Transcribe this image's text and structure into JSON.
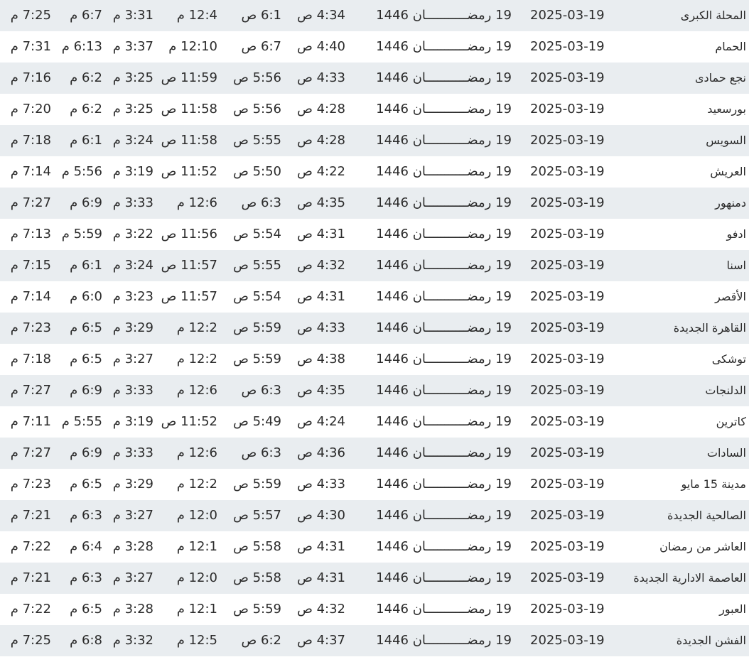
{
  "rows": [
    {
      "city": "المحلة الكبرى",
      "date": "2025-03-19",
      "hijri": "19 رمضـــــــــــان 1446",
      "fajr": "4:34 ص",
      "sunrise": "6:1 ص",
      "dhuhr": "12:4 م",
      "asr": "3:31 م",
      "maghrib": "6:7 م",
      "isha": "7:25 م"
    },
    {
      "city": "الحمام",
      "date": "2025-03-19",
      "hijri": "19 رمضـــــــــــان 1446",
      "fajr": "4:40 ص",
      "sunrise": "6:7 ص",
      "dhuhr": "12:10 م",
      "asr": "3:37 م",
      "maghrib": "6:13 م",
      "isha": "7:31 م"
    },
    {
      "city": "نجع حمادى",
      "date": "2025-03-19",
      "hijri": "19 رمضـــــــــــان 1446",
      "fajr": "4:33 ص",
      "sunrise": "5:56 ص",
      "dhuhr": "11:59 ص",
      "asr": "3:25 م",
      "maghrib": "6:2 م",
      "isha": "7:16 م"
    },
    {
      "city": "بورسعيد",
      "date": "2025-03-19",
      "hijri": "19 رمضـــــــــــان 1446",
      "fajr": "4:28 ص",
      "sunrise": "5:56 ص",
      "dhuhr": "11:58 ص",
      "asr": "3:25 م",
      "maghrib": "6:2 م",
      "isha": "7:20 م"
    },
    {
      "city": "السويس",
      "date": "2025-03-19",
      "hijri": "19 رمضـــــــــــان 1446",
      "fajr": "4:28 ص",
      "sunrise": "5:55 ص",
      "dhuhr": "11:58 ص",
      "asr": "3:24 م",
      "maghrib": "6:1 م",
      "isha": "7:18 م"
    },
    {
      "city": "العريش",
      "date": "2025-03-19",
      "hijri": "19 رمضـــــــــــان 1446",
      "fajr": "4:22 ص",
      "sunrise": "5:50 ص",
      "dhuhr": "11:52 ص",
      "asr": "3:19 م",
      "maghrib": "5:56 م",
      "isha": "7:14 م"
    },
    {
      "city": "دمنهور",
      "date": "2025-03-19",
      "hijri": "19 رمضـــــــــــان 1446",
      "fajr": "4:35 ص",
      "sunrise": "6:3 ص",
      "dhuhr": "12:6 م",
      "asr": "3:33 م",
      "maghrib": "6:9 م",
      "isha": "7:27 م"
    },
    {
      "city": "ادفو",
      "date": "2025-03-19",
      "hijri": "19 رمضـــــــــــان 1446",
      "fajr": "4:31 ص",
      "sunrise": "5:54 ص",
      "dhuhr": "11:56 ص",
      "asr": "3:22 م",
      "maghrib": "5:59 م",
      "isha": "7:13 م"
    },
    {
      "city": "اسنا",
      "date": "2025-03-19",
      "hijri": "19 رمضـــــــــــان 1446",
      "fajr": "4:32 ص",
      "sunrise": "5:55 ص",
      "dhuhr": "11:57 ص",
      "asr": "3:24 م",
      "maghrib": "6:1 م",
      "isha": "7:15 م"
    },
    {
      "city": "الأقصر",
      "date": "2025-03-19",
      "hijri": "19 رمضـــــــــــان 1446",
      "fajr": "4:31 ص",
      "sunrise": "5:54 ص",
      "dhuhr": "11:57 ص",
      "asr": "3:23 م",
      "maghrib": "6:0 م",
      "isha": "7:14 م"
    },
    {
      "city": "القاهرة الجديدة",
      "date": "2025-03-19",
      "hijri": "19 رمضـــــــــــان 1446",
      "fajr": "4:33 ص",
      "sunrise": "5:59 ص",
      "dhuhr": "12:2 م",
      "asr": "3:29 م",
      "maghrib": "6:5 م",
      "isha": "7:23 م"
    },
    {
      "city": "توشكى",
      "date": "2025-03-19",
      "hijri": "19 رمضـــــــــــان 1446",
      "fajr": "4:38 ص",
      "sunrise": "5:59 ص",
      "dhuhr": "12:2 م",
      "asr": "3:27 م",
      "maghrib": "6:5 م",
      "isha": "7:18 م"
    },
    {
      "city": "الدلنجات",
      "date": "2025-03-19",
      "hijri": "19 رمضـــــــــــان 1446",
      "fajr": "4:35 ص",
      "sunrise": "6:3 ص",
      "dhuhr": "12:6 م",
      "asr": "3:33 م",
      "maghrib": "6:9 م",
      "isha": "7:27 م"
    },
    {
      "city": "كاترين",
      "date": "2025-03-19",
      "hijri": "19 رمضـــــــــــان 1446",
      "fajr": "4:24 ص",
      "sunrise": "5:49 ص",
      "dhuhr": "11:52 ص",
      "asr": "3:19 م",
      "maghrib": "5:55 م",
      "isha": "7:11 م"
    },
    {
      "city": "السادات",
      "date": "2025-03-19",
      "hijri": "19 رمضـــــــــــان 1446",
      "fajr": "4:36 ص",
      "sunrise": "6:3 ص",
      "dhuhr": "12:6 م",
      "asr": "3:33 م",
      "maghrib": "6:9 م",
      "isha": "7:27 م"
    },
    {
      "city": "مدينة 15 مايو",
      "date": "2025-03-19",
      "hijri": "19 رمضـــــــــــان 1446",
      "fajr": "4:33 ص",
      "sunrise": "5:59 ص",
      "dhuhr": "12:2 م",
      "asr": "3:29 م",
      "maghrib": "6:5 م",
      "isha": "7:23 م"
    },
    {
      "city": "الصالحية الجديدة",
      "date": "2025-03-19",
      "hijri": "19 رمضـــــــــــان 1446",
      "fajr": "4:30 ص",
      "sunrise": "5:57 ص",
      "dhuhr": "12:0 م",
      "asr": "3:27 م",
      "maghrib": "6:3 م",
      "isha": "7:21 م"
    },
    {
      "city": "العاشر من رمضان",
      "date": "2025-03-19",
      "hijri": "19 رمضـــــــــــان 1446",
      "fajr": "4:31 ص",
      "sunrise": "5:58 ص",
      "dhuhr": "12:1 م",
      "asr": "3:28 م",
      "maghrib": "6:4 م",
      "isha": "7:22 م"
    },
    {
      "city": "العاصمة الادارية الجديدة",
      "date": "2025-03-19",
      "hijri": "19 رمضـــــــــــان 1446",
      "fajr": "4:31 ص",
      "sunrise": "5:58 ص",
      "dhuhr": "12:0 م",
      "asr": "3:27 م",
      "maghrib": "6:3 م",
      "isha": "7:21 م"
    },
    {
      "city": "العبور",
      "date": "2025-03-19",
      "hijri": "19 رمضـــــــــــان 1446",
      "fajr": "4:32 ص",
      "sunrise": "5:59 ص",
      "dhuhr": "12:1 م",
      "asr": "3:28 م",
      "maghrib": "6:5 م",
      "isha": "7:22 م"
    },
    {
      "city": "الفشن الجديدة",
      "date": "2025-03-19",
      "hijri": "19 رمضـــــــــــان 1446",
      "fajr": "4:37 ص",
      "sunrise": "6:2 ص",
      "dhuhr": "12:5 م",
      "asr": "3:32 م",
      "maghrib": "6:8 م",
      "isha": "7:25 م"
    }
  ],
  "colors": {
    "row_shaded": "#e9edf0",
    "text": "#2b2b2b"
  }
}
